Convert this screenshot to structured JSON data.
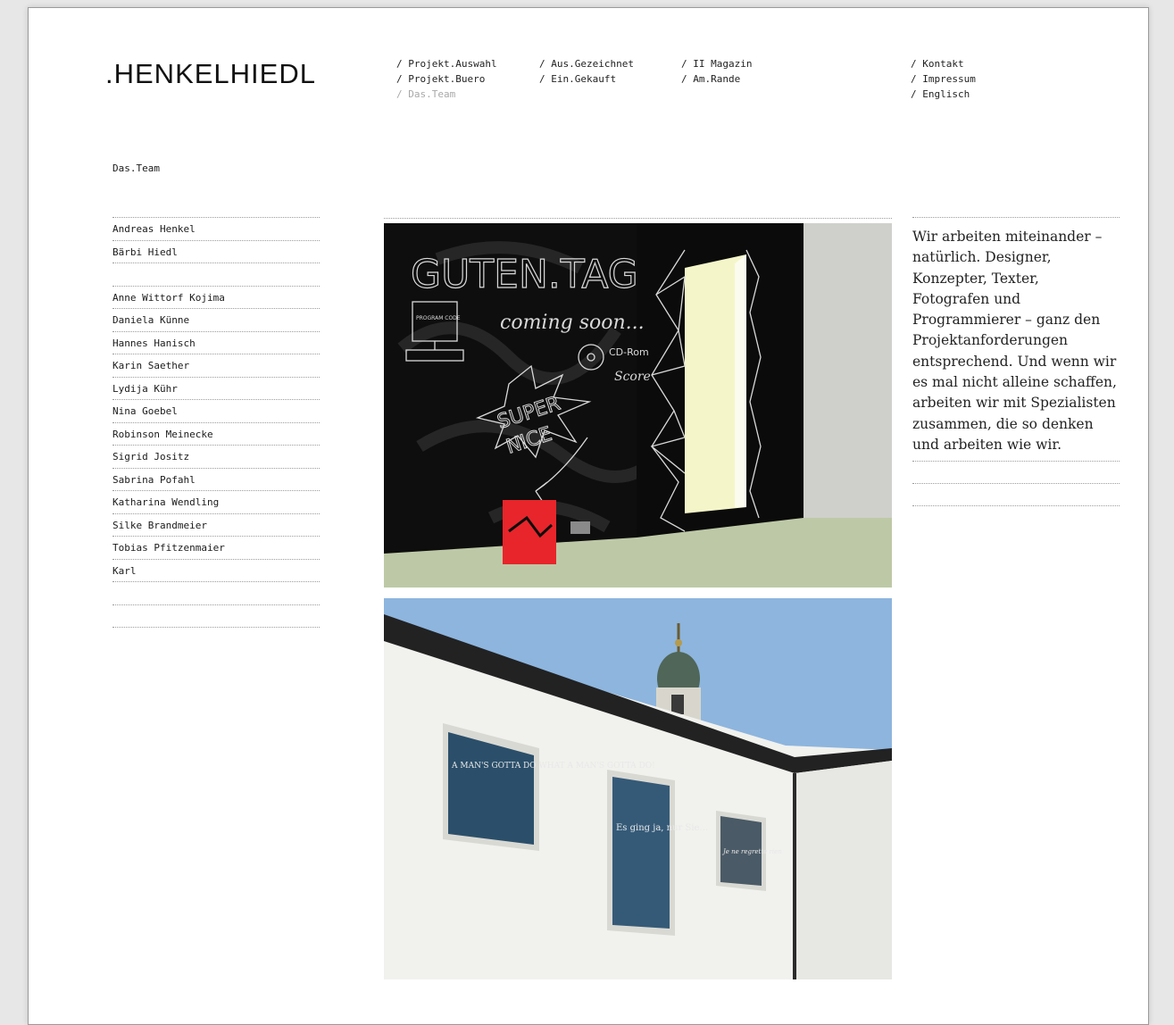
{
  "brand": {
    "logo": ".HENKELHIEDL"
  },
  "nav": {
    "col1": [
      "/ Projekt.Auswahl",
      "/ Projekt.Buero",
      "/ Das.Team"
    ],
    "col2": [
      "/ Aus.Gezeichnet",
      "/ Ein.Gekauft"
    ],
    "col3": [
      "/ II Magazin",
      "/ Am.Rande"
    ],
    "col4": [
      "/ Kontakt",
      "/ Impressum",
      "/ Englisch"
    ]
  },
  "section": {
    "title": "Das.Team"
  },
  "team": {
    "founders": [
      "Andreas Henkel",
      "Bärbi Hiedl"
    ],
    "members": [
      "Anne Wittorf Kojima",
      "Daniela Künne",
      "Hannes Hanisch",
      "Karin Saether",
      "Lydija Kühr",
      "Nina Goebel",
      "Robinson Meinecke",
      "Sigrid Jositz",
      "Sabrina Pofahl",
      "Katharina Wendling",
      "Silke Brandmeier",
      "Tobias Pfitzenmaier",
      "Karl"
    ]
  },
  "content": {
    "intro": "Wir arbeiten miteinander – natürlich.  Designer, Konzepter, Texter, Fotografen und Programmierer – ganz den Projektanforderungen entsprechend. Und wenn wir es mal nicht alleine schaffen, arbeiten wir mit Spezialisten zusammen, die so denken und arbeiten wie wir."
  },
  "photo1": {
    "chalk_title": "GUTEN.TAG",
    "chalk_sub": "coming soon...",
    "chalk_super": "SUPER",
    "chalk_nice": "NICE",
    "chalk_cd": "CD-Rom",
    "chalk_score": "Score",
    "chalk_screen": "PROGRAM CODE"
  },
  "photo2": {
    "window1": "A MAN'S GOTTA DO WHAT A MAN'S GOTTA DO!",
    "window2": "Es ging ja, nur Sie...",
    "window3": "Je ne regrette rien"
  },
  "colors": {
    "chalkboard": "#0e0e0e",
    "chalk": "#d9d9d9",
    "floor": "#bdc9a6",
    "door_light": "#f4f6c9",
    "sign_red": "#e8252a",
    "sky": "#8db5de",
    "wall": "#f1f1ee"
  },
  "icons": [
    "monitor-chalk-icon",
    "cd-chalk-icon",
    "arrow-chalk-icon"
  ]
}
